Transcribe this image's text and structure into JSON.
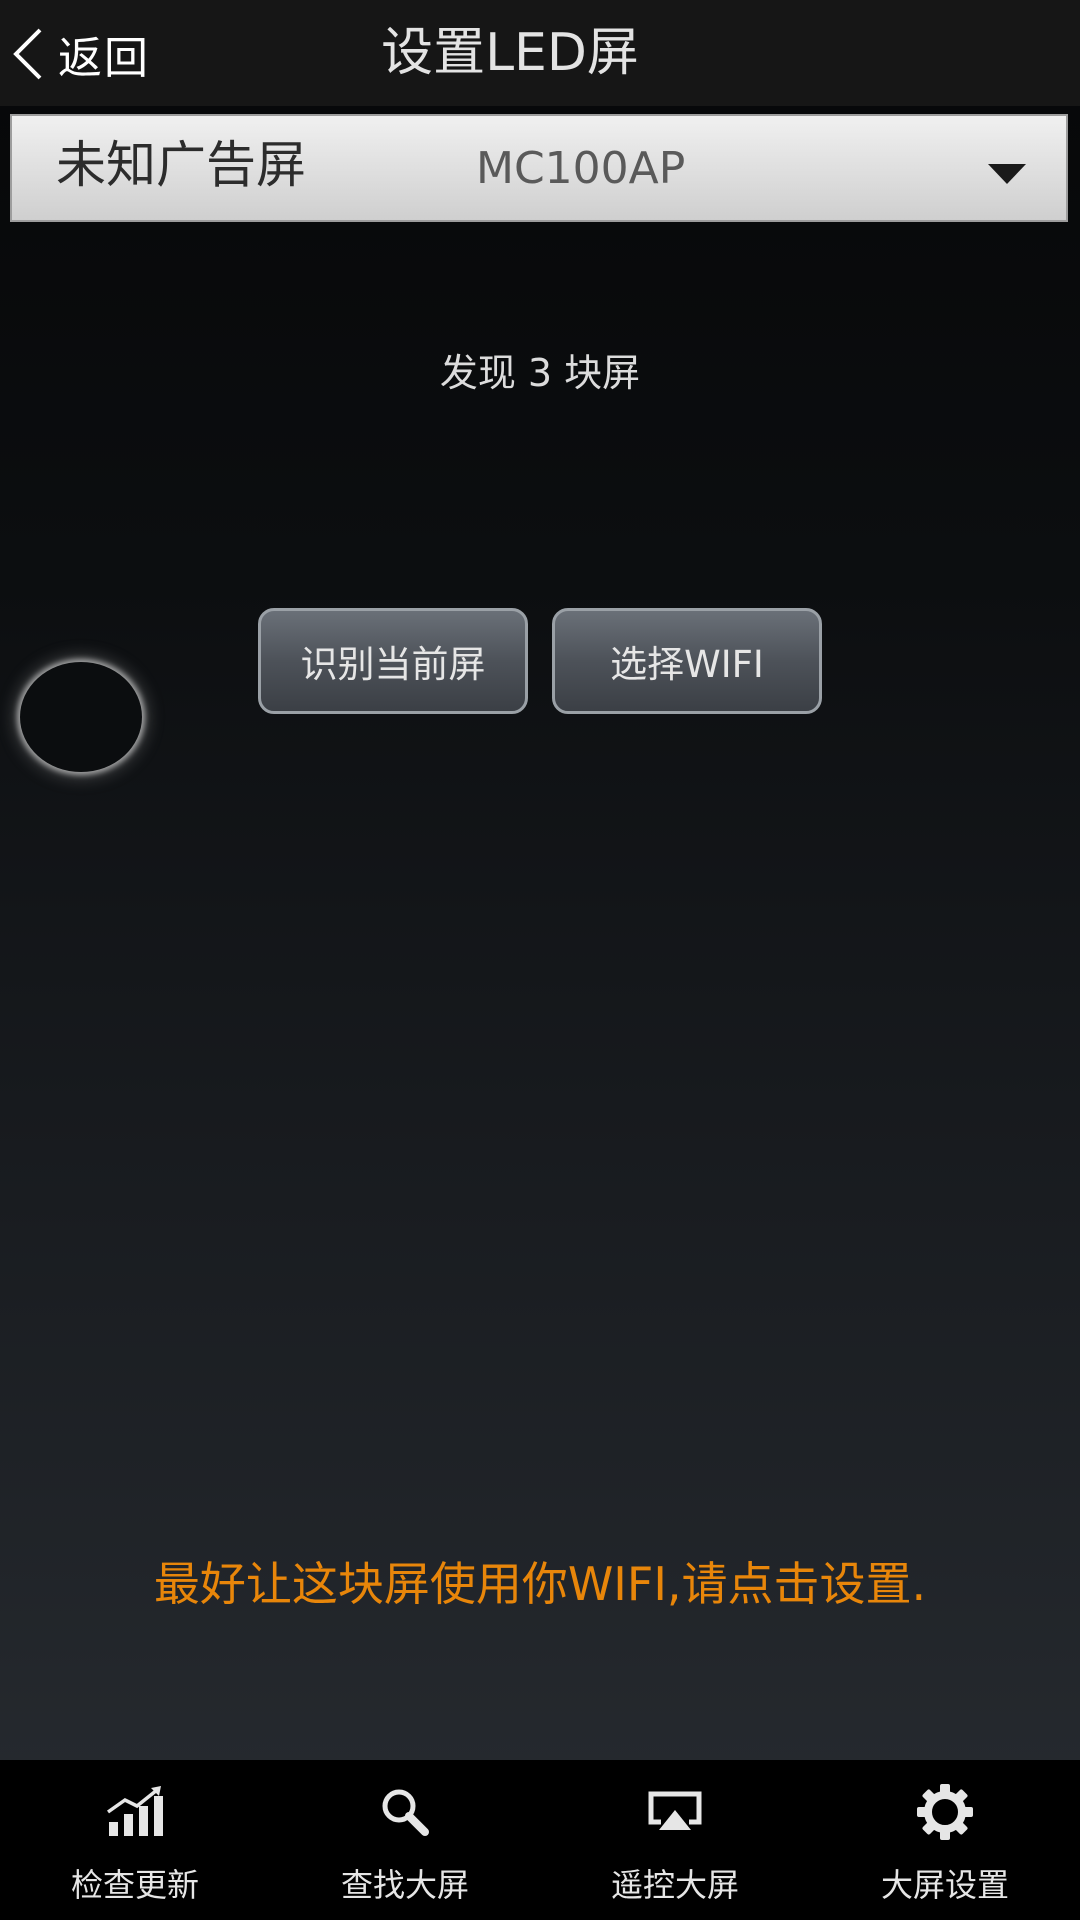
{
  "header": {
    "back_label": "返回",
    "title": "设置LED屏"
  },
  "selector": {
    "name": "未知广告屏",
    "model": "MC100AP"
  },
  "found_text": "发现 3 块屏",
  "buttons": {
    "identify_label": "识别当前屏",
    "wifi_label": "选择WIFI"
  },
  "hint_text": "最好让这块屏使用你WIFI,请点击设置.",
  "bottom_nav": {
    "items": [
      {
        "label": "检查更新",
        "icon": "bar-chart-icon"
      },
      {
        "label": "查找大屏",
        "icon": "search-icon"
      },
      {
        "label": "遥控大屏",
        "icon": "airplay-icon"
      },
      {
        "label": "大屏设置",
        "icon": "gear-icon"
      }
    ]
  },
  "colors": {
    "hint": "#e8860a",
    "topbar": "#161616",
    "bottom_nav": "#000000"
  }
}
